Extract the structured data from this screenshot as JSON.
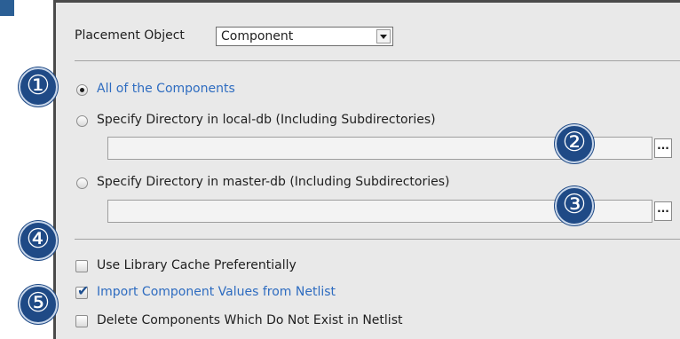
{
  "placement_object": {
    "label": "Placement Object",
    "selected_value": "Component"
  },
  "scope_options": [
    {
      "label": "All of the Components",
      "selected": true
    },
    {
      "label": "Specify Directory in local-db (Including Subdirectories)",
      "selected": false
    },
    {
      "label": "Specify Directory in master-db (Including Subdirectories)",
      "selected": false
    }
  ],
  "local_db_path": {
    "value": ""
  },
  "master_db_path": {
    "value": ""
  },
  "browse_label": "...",
  "checkboxes": [
    {
      "label": "Use Library Cache Preferentially",
      "checked": false
    },
    {
      "label": "Import Component Values from Netlist",
      "checked": true
    },
    {
      "label": "Delete Components Which Do Not Exist in Netlist",
      "checked": false
    }
  ],
  "callouts": [
    "①",
    "②",
    "③",
    "④",
    "⑤"
  ],
  "colors": {
    "badge": "#1f4a86",
    "selected_text": "#2e6cc0",
    "panel": "#e9e9e9",
    "frame": "#4a4a4a"
  }
}
